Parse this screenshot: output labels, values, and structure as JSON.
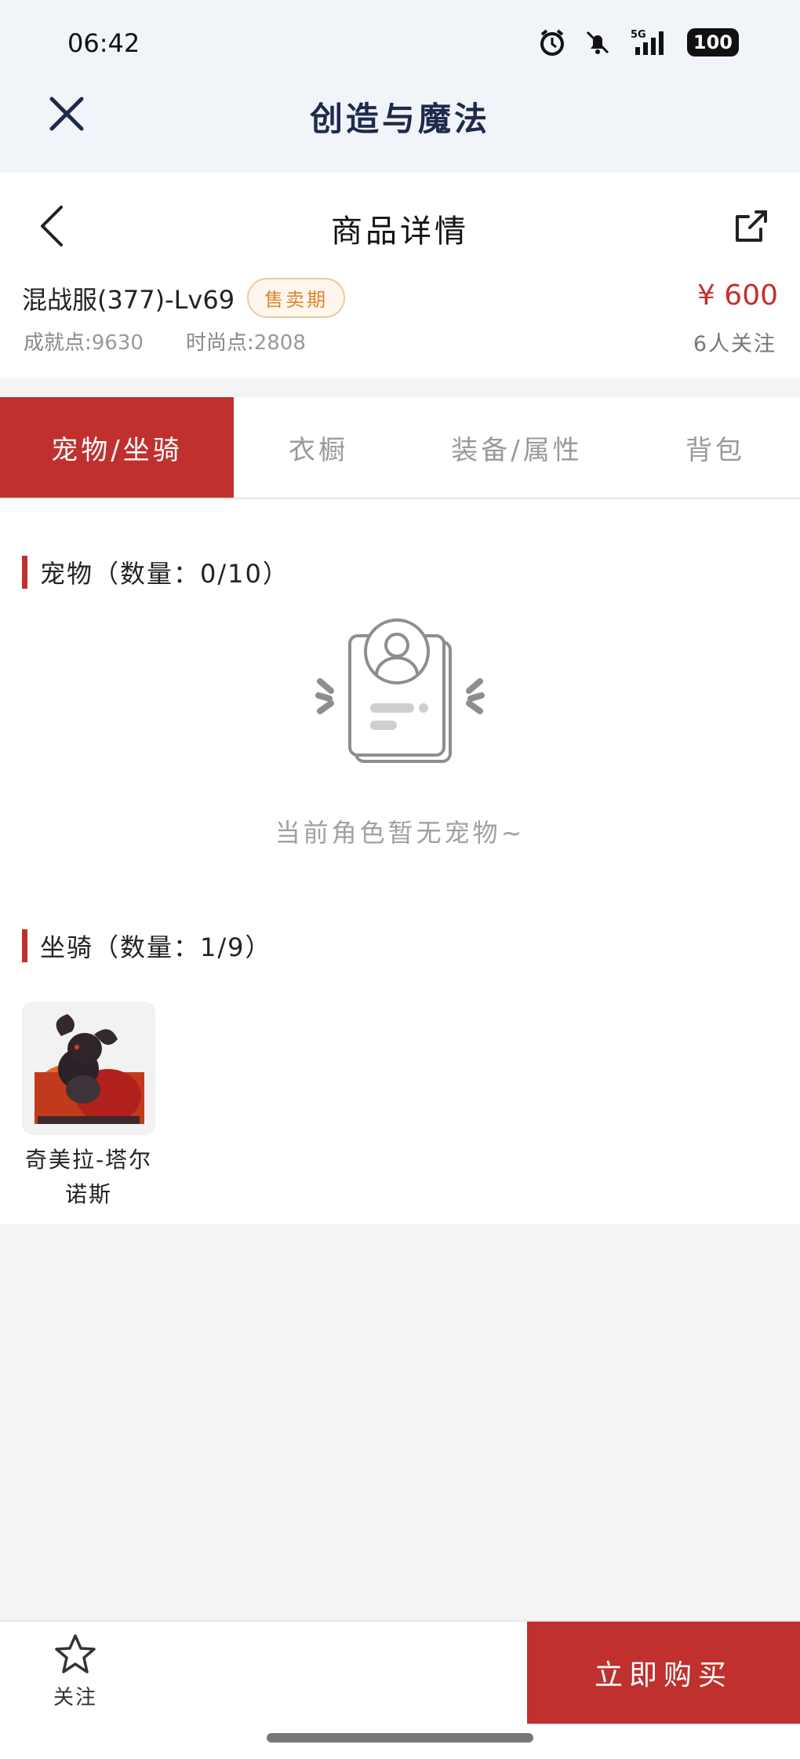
{
  "status_bar": {
    "time": "06:42",
    "network": "5G",
    "battery": "100",
    "icons": [
      "alarm-icon",
      "mute-bell-icon",
      "signal-icon",
      "battery-icon"
    ]
  },
  "app_header": {
    "title": "创造与魔法",
    "close_icon": "close-icon"
  },
  "page_header": {
    "title": "商品详情",
    "back_icon": "chevron-left-icon",
    "share_icon": "share-icon"
  },
  "product": {
    "name": "混战服(377)-Lv69",
    "badge": "售卖期",
    "price": "¥ 600",
    "achievement_label": "成就点:",
    "achievement_value": "9630",
    "fashion_label": "时尚点:",
    "fashion_value": "2808",
    "followers": "6人关注"
  },
  "tabs": [
    {
      "label": "宠物/坐骑",
      "active": true
    },
    {
      "label": "衣橱",
      "active": false
    },
    {
      "label": "装备/属性",
      "active": false
    },
    {
      "label": "背包",
      "active": false
    }
  ],
  "pets": {
    "title": "宠物（数量：0/10）",
    "empty_text": "当前角色暂无宠物~"
  },
  "mounts": {
    "title": "坐骑（数量：1/9）",
    "items": [
      {
        "name": "奇美拉-塔尔诺斯"
      }
    ]
  },
  "bottom_bar": {
    "follow_label": "关注",
    "buy_label": "立即购买"
  },
  "colors": {
    "accent": "#c0302e",
    "price": "#c4302d",
    "badge": "#e0852b",
    "title": "#1e2a4d"
  }
}
